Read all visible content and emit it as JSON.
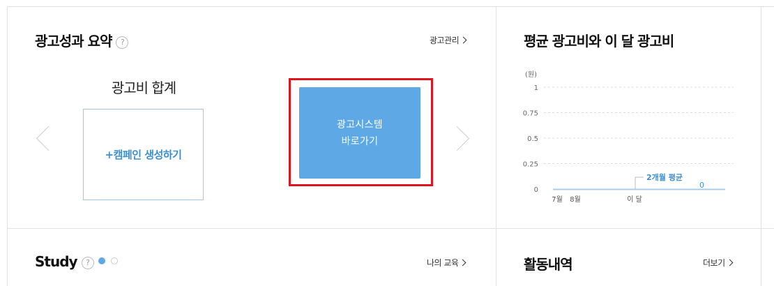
{
  "summary": {
    "title": "광고성과 요약",
    "help_icon": "?",
    "manage_link": "광고관리",
    "spend_total_label": "광고비 합계",
    "create_campaign": "+캠페인 생성하기",
    "go_system_line1": "광고시스템",
    "go_system_line2": "바로가기"
  },
  "spend_chart": {
    "title": "평균 광고비와 이 달 광고비",
    "unit": "(원)",
    "avg_label": "2개월 평균",
    "current_value_label": "0"
  },
  "study": {
    "title": "Study",
    "help_icon": "?",
    "my_edu_link": "나의 교육"
  },
  "activity": {
    "title": "활동내역",
    "more_link": "더보기"
  },
  "chart_data": {
    "type": "bar",
    "categories": [
      "7월",
      "8월",
      "이 달"
    ],
    "values": [
      0,
      0,
      0
    ],
    "yticks": [
      "1",
      "0.75",
      "0.5",
      "0.25",
      "0"
    ],
    "ylim": [
      0,
      1
    ],
    "ylabel": "(원)",
    "annotations": [
      {
        "label": "2개월 평균",
        "value": 0
      },
      {
        "label": "0",
        "value": 0
      }
    ],
    "grid": true
  },
  "colors": {
    "accent": "#5ea9e5",
    "link_blue": "#3d8fd1",
    "highlight_red": "#e0141e",
    "border": "#e1e1e1"
  }
}
